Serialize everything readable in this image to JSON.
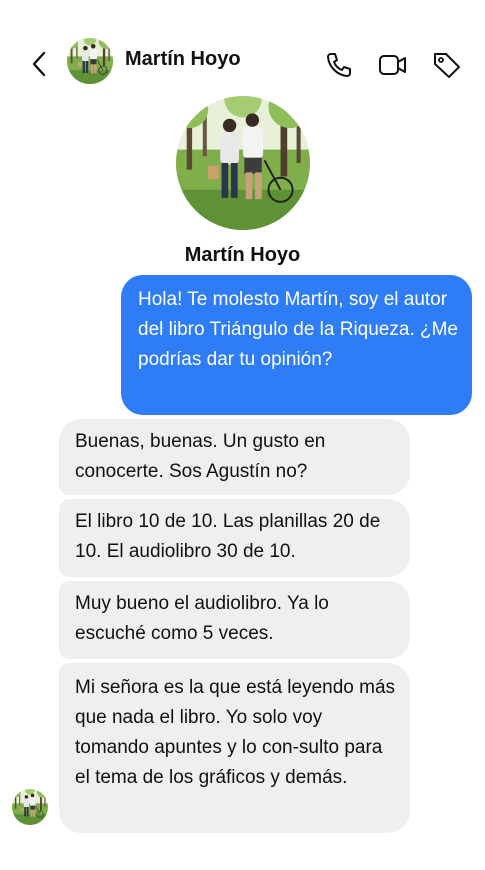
{
  "contact": {
    "name": "Martín Hoyo"
  },
  "header": {
    "back_icon": "chevron-left-icon",
    "call_icon": "phone-icon",
    "video_icon": "video-camera-icon",
    "tag_icon": "tag-icon"
  },
  "messages": [
    {
      "direction": "outgoing",
      "text": "Hola! Te molesto Martín, soy el autor del libro Triángulo de la Riqueza. ¿Me podrías dar tu opinión?"
    },
    {
      "direction": "incoming",
      "text": "Buenas, buenas. Un gusto en conocerte. Sos Agustín no?"
    },
    {
      "direction": "incoming",
      "text": "El libro 10 de 10. Las planillas 20 de 10. El audiolibro 30 de 10."
    },
    {
      "direction": "incoming",
      "text": "Muy bueno el audiolibro. Ya lo escuché como 5 veces."
    },
    {
      "direction": "incoming",
      "text": "Mi señora es la que está leyendo más que nada el libro. Yo solo voy tomando apuntes y lo con-sulto para el tema de los gráficos y demás."
    }
  ],
  "colors": {
    "outgoing_bubble": "#2e7cf6",
    "incoming_bubble": "#efefef",
    "background": "#ffffff"
  }
}
